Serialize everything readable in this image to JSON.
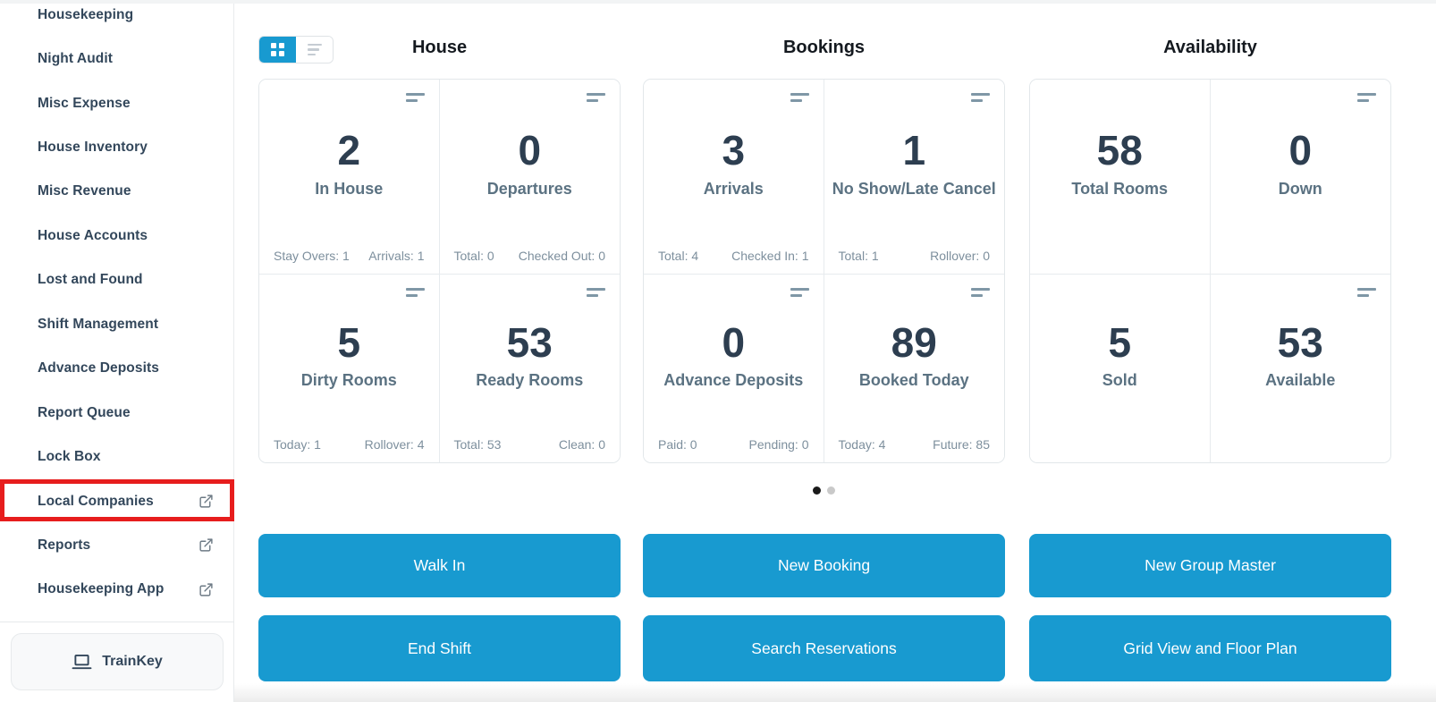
{
  "colors": {
    "accent": "#189AD0",
    "highlight_red": "#E71D1D",
    "number_text": "#2d3e50",
    "label_text": "#5b7282",
    "sidebar_text": "#33475b"
  },
  "icons": {
    "view_grid": "grid-2x2-squares",
    "view_list": "three-lines",
    "card_menu": "two-sort-lines",
    "external_link": "box-with-arrow",
    "trainkey": "laptop"
  },
  "sidebar": {
    "items": [
      {
        "label": "Housekeeping",
        "external": false
      },
      {
        "label": "Night Audit",
        "external": false
      },
      {
        "label": "Misc Expense",
        "external": false
      },
      {
        "label": "House Inventory",
        "external": false
      },
      {
        "label": "Misc Revenue",
        "external": false
      },
      {
        "label": "House Accounts",
        "external": false
      },
      {
        "label": "Lost and Found",
        "external": false
      },
      {
        "label": "Shift Management",
        "external": false
      },
      {
        "label": "Advance Deposits",
        "external": false
      },
      {
        "label": "Report Queue",
        "external": false
      },
      {
        "label": "Lock Box",
        "external": false
      },
      {
        "label": "Local Companies",
        "external": true,
        "highlighted": true
      },
      {
        "label": "Reports",
        "external": true
      },
      {
        "label": "Housekeeping App",
        "external": true
      }
    ],
    "trainkey_label": "TrainKey"
  },
  "carousel": {
    "dot_count": 2,
    "active_index": 0
  },
  "columns": [
    {
      "title": "House",
      "cards": [
        {
          "value": "2",
          "label": "In House",
          "footer_left": "Stay Overs: 1",
          "footer_right": "Arrivals: 1",
          "menu_icon": true
        },
        {
          "value": "0",
          "label": "Departures",
          "footer_left": "Total: 0",
          "footer_right": "Checked Out: 0",
          "menu_icon": true
        },
        {
          "value": "5",
          "label": "Dirty Rooms",
          "footer_left": "Today: 1",
          "footer_right": "Rollover: 4",
          "menu_icon": true
        },
        {
          "value": "53",
          "label": "Ready Rooms",
          "footer_left": "Total: 53",
          "footer_right": "Clean: 0",
          "menu_icon": true
        }
      ],
      "buttons": [
        "Walk In",
        "End Shift"
      ]
    },
    {
      "title": "Bookings",
      "cards": [
        {
          "value": "3",
          "label": "Arrivals",
          "footer_left": "Total: 4",
          "footer_right": "Checked In: 1",
          "menu_icon": true
        },
        {
          "value": "1",
          "label": "No Show/Late Cancel",
          "footer_left": "Total: 1",
          "footer_right": "Rollover: 0",
          "menu_icon": true
        },
        {
          "value": "0",
          "label": "Advance Deposits",
          "footer_left": "Paid: 0",
          "footer_right": "Pending: 0",
          "menu_icon": true
        },
        {
          "value": "89",
          "label": "Booked Today",
          "footer_left": "Today: 4",
          "footer_right": "Future: 85",
          "menu_icon": true
        }
      ],
      "buttons": [
        "New Booking",
        "Search Reservations"
      ]
    },
    {
      "title": "Availability",
      "cards": [
        {
          "value": "58",
          "label": "Total Rooms",
          "menu_icon": false
        },
        {
          "value": "0",
          "label": "Down",
          "menu_icon": true
        },
        {
          "value": "5",
          "label": "Sold",
          "menu_icon": false
        },
        {
          "value": "53",
          "label": "Available",
          "menu_icon": true
        }
      ],
      "buttons": [
        "New Group Master",
        "Grid View and Floor Plan"
      ]
    }
  ]
}
